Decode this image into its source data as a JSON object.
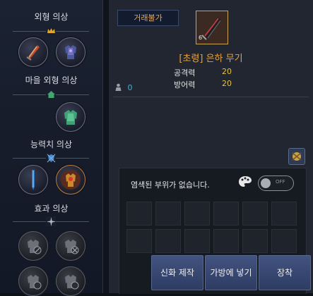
{
  "left_panel": {
    "sections": [
      {
        "title": "외형 의상"
      },
      {
        "title": "마을 외형 의상"
      },
      {
        "title": "능력치 의상"
      },
      {
        "title": "효과 의상"
      }
    ]
  },
  "item": {
    "tag": "거래불가",
    "name": "[초령] 은하 무기",
    "stats": [
      {
        "label": "공격력",
        "value": "20"
      },
      {
        "label": "방어력",
        "value": "20"
      }
    ],
    "count": "0",
    "icon_badge": "6"
  },
  "dye": {
    "message": "염색된 부위가 없습니다.",
    "toggle_label": "OFF"
  },
  "buttons": {
    "myth": "신화 제작",
    "bag": "가방에 넣기",
    "equip": "장착"
  },
  "colors": {
    "accent_gold": "#e8a240",
    "stat_value": "#e8c040",
    "count_blue": "#3fb3d8",
    "button_blue": "#34426b"
  }
}
